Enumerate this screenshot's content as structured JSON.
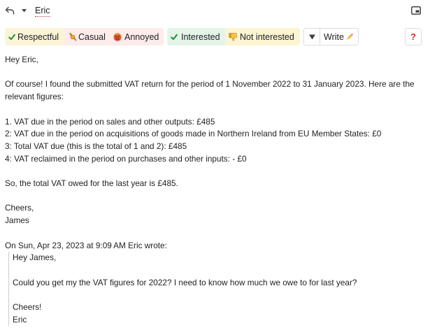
{
  "header": {
    "reply_icon": "reply-icon",
    "recipients_menu_icon": "chevron-down-icon",
    "recipient": "Eric",
    "popout_icon": "popout-icon"
  },
  "toolbar": {
    "tone_buttons": [
      {
        "label": "Respectful",
        "icon": "check-icon",
        "bg": "#fcf4d6"
      },
      {
        "label": "Casual",
        "icon": "casual-icon",
        "bg": "#fdecea"
      },
      {
        "label": "Annoyed",
        "icon": "angry-face-icon",
        "bg": "#fdecea"
      }
    ],
    "interest_buttons": [
      {
        "label": "Interested",
        "icon": "check-icon",
        "bg": "#e4f4e7"
      },
      {
        "label": "Not interested",
        "icon": "thumbs-down-icon",
        "bg": "#fdf4d2"
      }
    ],
    "more_options_icon": "triangle-down-icon",
    "write_label": "Write",
    "write_icon": "pencil-icon",
    "help_label": "?"
  },
  "reply": {
    "greeting": "Hey Eric,",
    "intro": "Of course! I found the submitted VAT return for the period of 1 November 2022 to 31 January 2023. Here are the relevant figures:",
    "figures": [
      "1. VAT due in the period on sales and other outputs: £485",
      "2: VAT due in the period on acquisitions of goods made in Northern Ireland from EU Member States: £0",
      "3: Total VAT due (this is the total of 1 and 2): £485",
      "4: VAT reclaimed in the period on purchases and other inputs: - £0"
    ],
    "summary": "So, the total VAT owed for the last year is £485.",
    "signoff": "Cheers,",
    "signature": "James"
  },
  "quoted": {
    "attribution": "On Sun, Apr 23, 2023 at 9:09 AM Eric wrote:",
    "greeting": "Hey James,",
    "message": "Could you get my the VAT figures for 2022? I need to know how much we owe to for last year?",
    "signoff": "Cheers!",
    "signature": "Eric"
  },
  "colors": {
    "text": "#222222",
    "check": "#1e8e3e",
    "help_mark": "#d93025",
    "spellcheck_underline": "#d93025",
    "button_border": "#dadce0",
    "quote_border": "#cccccc"
  }
}
